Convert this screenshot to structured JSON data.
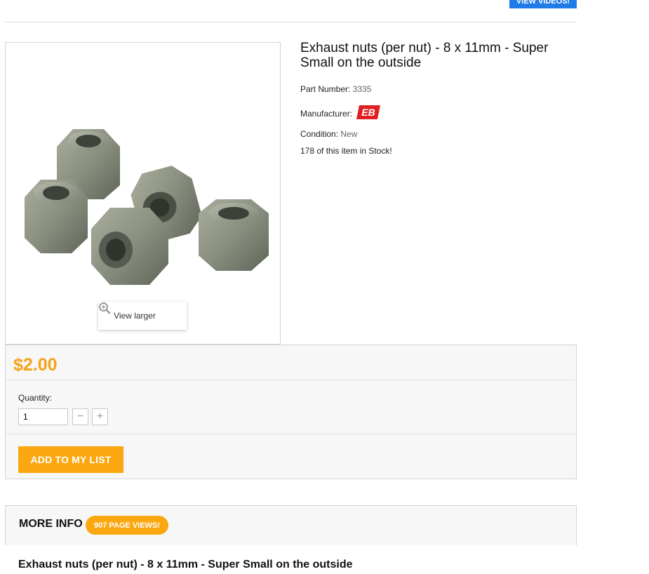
{
  "header": {
    "top_button_label": "VIEW VIDEOS!"
  },
  "product": {
    "title": "Exhaust nuts (per nut) - 8 x 11mm - Super Small on the outside",
    "part_number_label": "Part Number:",
    "part_number": "3335",
    "manufacturer_label": "Manufacturer:",
    "manufacturer_logo": "EB",
    "condition_label": "Condition:",
    "condition": "New",
    "stock_text": "178 of this item in Stock!",
    "view_larger_label": "View larger"
  },
  "purchase": {
    "price": "$2.00",
    "quantity_label": "Quantity:",
    "quantity_value": "1",
    "minus_symbol": "−",
    "plus_symbol": "+",
    "add_button_label": "ADD TO MY LIST"
  },
  "more_info": {
    "title": "MORE INFO",
    "views_badge": "907 PAGE VIEWS!",
    "description_title": "Exhaust nuts (per nut) - 8 x 11mm - Super Small on the outside"
  },
  "colors": {
    "accent": "#fba70f",
    "price": "#f5a316",
    "top_button": "#1e7be8"
  }
}
